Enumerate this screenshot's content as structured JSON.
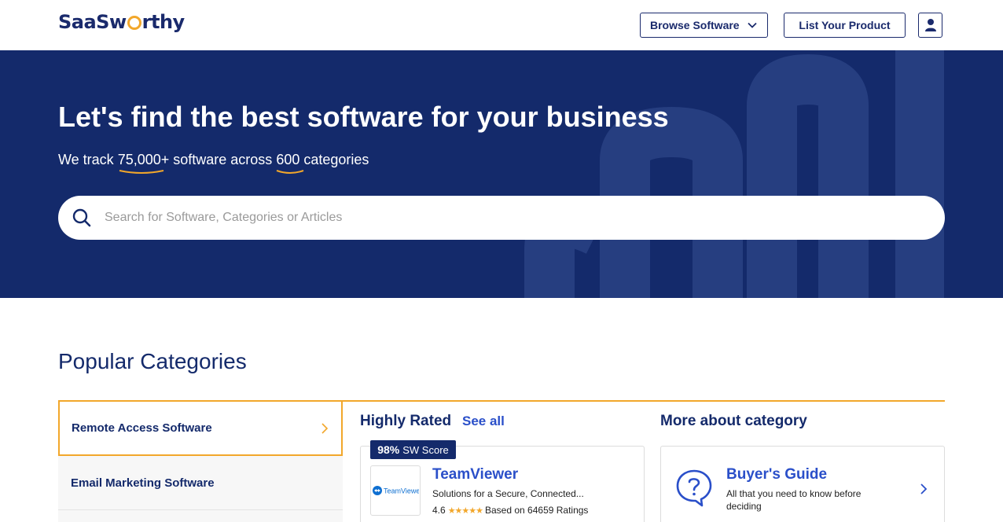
{
  "header": {
    "logo_text_pre": "SaaSw",
    "logo_text_post": "rthy",
    "browse_label": "Browse Software",
    "list_label": "List Your Product",
    "user_icon": "user-icon"
  },
  "hero": {
    "title": "Let's find the best software for your business",
    "sub_pre": "We track ",
    "sub_count": "75,000+",
    "sub_mid": " software across ",
    "sub_categories": "600",
    "sub_post": " categories",
    "search_placeholder": "Search for Software, Categories or Articles"
  },
  "categories": {
    "title": "Popular Categories",
    "items": [
      {
        "label": "Remote Access Software",
        "active": true
      },
      {
        "label": "Email Marketing Software",
        "active": false
      }
    ]
  },
  "highly_rated": {
    "title": "Highly Rated",
    "see_all": "See all",
    "product": {
      "score": "98%",
      "score_label": "SW Score",
      "logo_text": "TeamViewer",
      "name": "TeamViewer",
      "description": "Solutions for a Secure, Connected...",
      "rating": "4.6",
      "stars": "★★★★★",
      "ratings_text": "Based on 64659 Ratings"
    }
  },
  "more_about": {
    "title": "More about category",
    "guide_title": "Buyer's Guide",
    "guide_desc": "All that you need to know before deciding"
  },
  "colors": {
    "navy": "#142a6b",
    "accent": "#f2a72b",
    "link": "#2a4fc9"
  }
}
